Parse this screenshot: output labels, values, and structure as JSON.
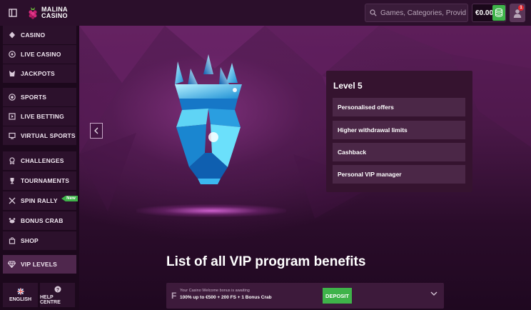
{
  "header": {
    "logo_line1": "MALINA",
    "logo_line2": "CASINO",
    "search_placeholder": "Games, Categories, Providers",
    "balance": "€0.00",
    "notification_count": "1"
  },
  "sidebar": {
    "items": [
      {
        "label": "CASINO",
        "icon": "casino-icon"
      },
      {
        "label": "LIVE CASINO",
        "icon": "roulette-icon"
      },
      {
        "label": "JACKPOTS",
        "icon": "jackpot-icon"
      },
      {
        "label": "SPORTS",
        "icon": "soccer-ball-icon"
      },
      {
        "label": "LIVE BETTING",
        "icon": "live-betting-icon"
      },
      {
        "label": "VIRTUAL SPORTS",
        "icon": "virtual-sports-icon"
      },
      {
        "label": "CHALLENGES",
        "icon": "medal-icon"
      },
      {
        "label": "TOURNAMENTS",
        "icon": "trophy-icon"
      },
      {
        "label": "SPIN RALLY",
        "icon": "spin-rally-icon",
        "badge": "New"
      },
      {
        "label": "BONUS CRAB",
        "icon": "crab-icon"
      },
      {
        "label": "SHOP",
        "icon": "shop-icon"
      },
      {
        "label": "VIP LEVELS",
        "icon": "diamond-icon"
      }
    ],
    "language_label": "ENGLISH",
    "help_label": "HELP CENTRE"
  },
  "vip": {
    "level_title": "Level 5",
    "benefits": [
      "Personalised offers",
      "Higher withdrawal limits",
      "Cashback",
      "Personal VIP manager"
    ]
  },
  "list_title": "List of all VIP program benefits",
  "promo": {
    "letter": "F",
    "subtext": "Your Casino Welcome bonus is awaiting",
    "main_text": "100% up to €500 + 200 FS + 1 Bonus Crab",
    "deposit_label": "DEPOSIT"
  },
  "colors": {
    "accent_green": "#3fb34a",
    "sidebar_bg": "#1c081c",
    "panel_bg": "#35132f"
  }
}
